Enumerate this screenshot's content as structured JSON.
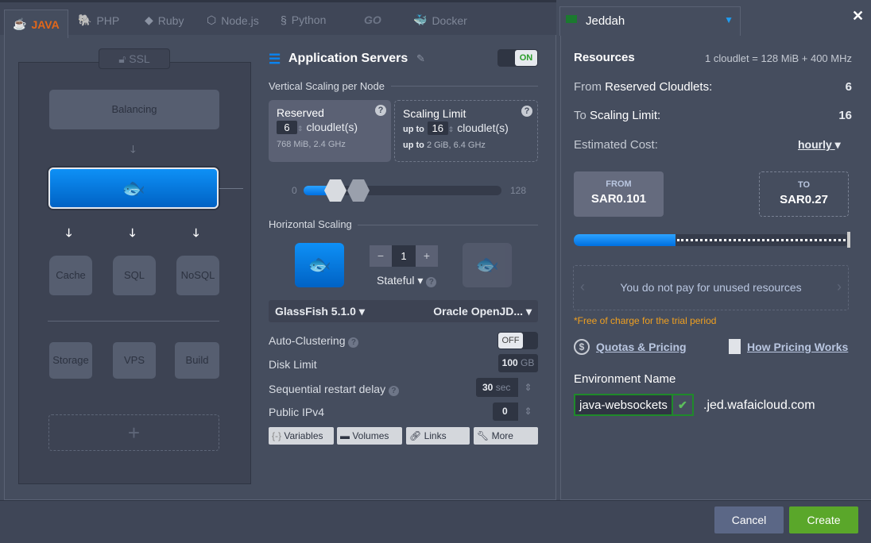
{
  "tabs": [
    {
      "label": "JAVA",
      "icon": "java-icon",
      "active": true
    },
    {
      "label": "PHP",
      "icon": "php-icon"
    },
    {
      "label": "Ruby",
      "icon": "ruby-icon"
    },
    {
      "label": "Node.js",
      "icon": "nodejs-icon"
    },
    {
      "label": "Python",
      "icon": "python-icon"
    },
    {
      "label": "GO",
      "icon": "go-icon"
    },
    {
      "label": "Docker",
      "icon": "docker-icon"
    }
  ],
  "topology": {
    "ssl": "SSL",
    "balancing": "Balancing",
    "cache": "Cache",
    "sql": "SQL",
    "nosql": "NoSQL",
    "storage": "Storage",
    "vps": "VPS",
    "build": "Build",
    "add": "+"
  },
  "app": {
    "title": "Application Servers",
    "toggle": "ON",
    "vertical_label": "Vertical Scaling per Node",
    "reserved": {
      "title": "Reserved",
      "value": "6",
      "unit": "cloudlet(s)",
      "spec": "768 MiB, 2.4 GHz"
    },
    "limit": {
      "title": "Scaling Limit",
      "prefix": "up to",
      "value": "16",
      "unit": "cloudlet(s)",
      "spec_prefix": "up to",
      "spec": "2 GiB, 6.4 GHz"
    },
    "slider": {
      "min": "0",
      "max": "128",
      "reserved": 6,
      "limit": 16
    },
    "horizontal_label": "Horizontal Scaling",
    "nodes": "1",
    "minus": "−",
    "plus": "+",
    "mode": "Stateful",
    "server": "GlassFish 5.1.0",
    "jdk": "Oracle OpenJD...",
    "auto_clustering": "Auto-Clustering",
    "auto_clustering_value": "OFF",
    "disk_label": "Disk Limit",
    "disk_value": "100",
    "disk_unit": "GB",
    "restart_label": "Sequential restart delay",
    "restart_value": "30",
    "restart_unit": "sec",
    "ipv4_label": "Public IPv4",
    "ipv4_value": "0",
    "buttons": [
      "Variables",
      "Volumes",
      "Links",
      "More"
    ]
  },
  "region": {
    "name": "Jeddah"
  },
  "resources": {
    "title": "Resources",
    "cloudlet_def": "1 cloudlet = 128 MiB + 400 MHz",
    "from_label": "From",
    "from_label2": "Reserved Cloudlets:",
    "from_value": "6",
    "to_label": "To",
    "to_label2": "Scaling Limit:",
    "to_value": "16",
    "cost_label": "Estimated Cost:",
    "cost_period": "hourly",
    "price_from_label": "FROM",
    "price_from": "SAR0.101",
    "price_to_label": "TO",
    "price_to": "SAR0.27",
    "carousel": "You do not pay for unused resources",
    "trial": "*Free of charge for the trial period",
    "quotas": "Quotas & Pricing",
    "how": "How Pricing Works"
  },
  "env": {
    "label": "Environment Name",
    "value": "java-websockets",
    "domain": ".jed.wafaicloud.com"
  },
  "footer": {
    "cancel": "Cancel",
    "create": "Create"
  },
  "colors": {
    "accent": "#0a84f0",
    "create": "#5aa72a",
    "trial": "#f0a020"
  }
}
